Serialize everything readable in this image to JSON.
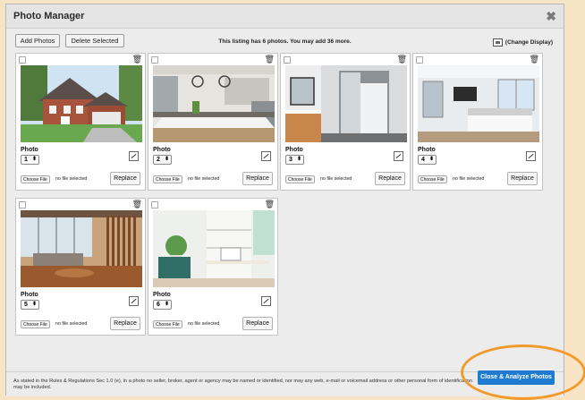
{
  "dialog": {
    "title": "Photo Manager",
    "close_glyph": "✖"
  },
  "toolbar": {
    "add_photos": "Add Photos",
    "delete_selected": "Delete Selected",
    "info": "This listing has 6 photos. You may add 36 more.",
    "change_display": "(Change Display)"
  },
  "photos": [
    {
      "label": "Photo",
      "number": "1",
      "choose": "Choose File",
      "status": "no file selected",
      "replace": "Replace",
      "scene": "house-exterior"
    },
    {
      "label": "Photo",
      "number": "2",
      "choose": "Choose File",
      "status": "no file selected",
      "replace": "Replace",
      "scene": "kitchen"
    },
    {
      "label": "Photo",
      "number": "3",
      "choose": "Choose File",
      "status": "no file selected",
      "replace": "Replace",
      "scene": "bathroom"
    },
    {
      "label": "Photo",
      "number": "4",
      "choose": "Choose File",
      "status": "no file selected",
      "replace": "Replace",
      "scene": "bedroom"
    },
    {
      "label": "Photo",
      "number": "5",
      "choose": "Choose File",
      "status": "no file selected",
      "replace": "Replace",
      "scene": "living-room"
    },
    {
      "label": "Photo",
      "number": "6",
      "choose": "Choose File",
      "status": "no file selected",
      "replace": "Replace",
      "scene": "office"
    }
  ],
  "footer": {
    "disclaimer": "As stated in the Rules & Regulations Sec 1.0 (e), in a photo no seller, broker, agent or agency may be named or identified, nor may any web, e-mail or voicemail address or other personal form of identification may be included.",
    "analyze_button": "Close & Analyze Photos"
  },
  "colors": {
    "accent": "#1e7bd0",
    "highlight_ring": "#f39a2c",
    "page_background": "#f6e4c4"
  }
}
